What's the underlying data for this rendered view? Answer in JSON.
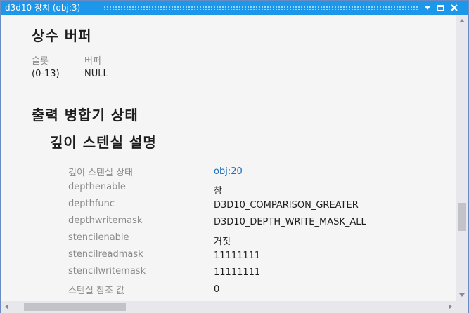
{
  "window": {
    "title": "d3d10 장치 (obj:3)",
    "accent_color": "#1c97ea"
  },
  "constant_buffer": {
    "heading": "상수 버퍼",
    "slot_header": "슬롯",
    "buffer_header": "버퍼",
    "slot_value": "(0-13)",
    "buffer_value": "NULL"
  },
  "output_merger": {
    "heading": "출력 병합기 상태",
    "depth_stencil_heading": "깊이 스텐실 설명",
    "properties": [
      {
        "key": "깊이 스텐실 상태",
        "value": "obj:20"
      },
      {
        "key": "depthenable",
        "value": "참"
      },
      {
        "key": "depthfunc",
        "value": "D3D10_COMPARISON_GREATER"
      },
      {
        "key": "depthwritemask",
        "value": "D3D10_DEPTH_WRITE_MASK_ALL"
      },
      {
        "key": "stencilenable",
        "value": "거짓"
      },
      {
        "key": "stencilreadmask",
        "value": "11111111"
      },
      {
        "key": "stencilwritemask",
        "value": "11111111"
      },
      {
        "key": "스텐실 참조 값",
        "value": "0"
      }
    ]
  }
}
